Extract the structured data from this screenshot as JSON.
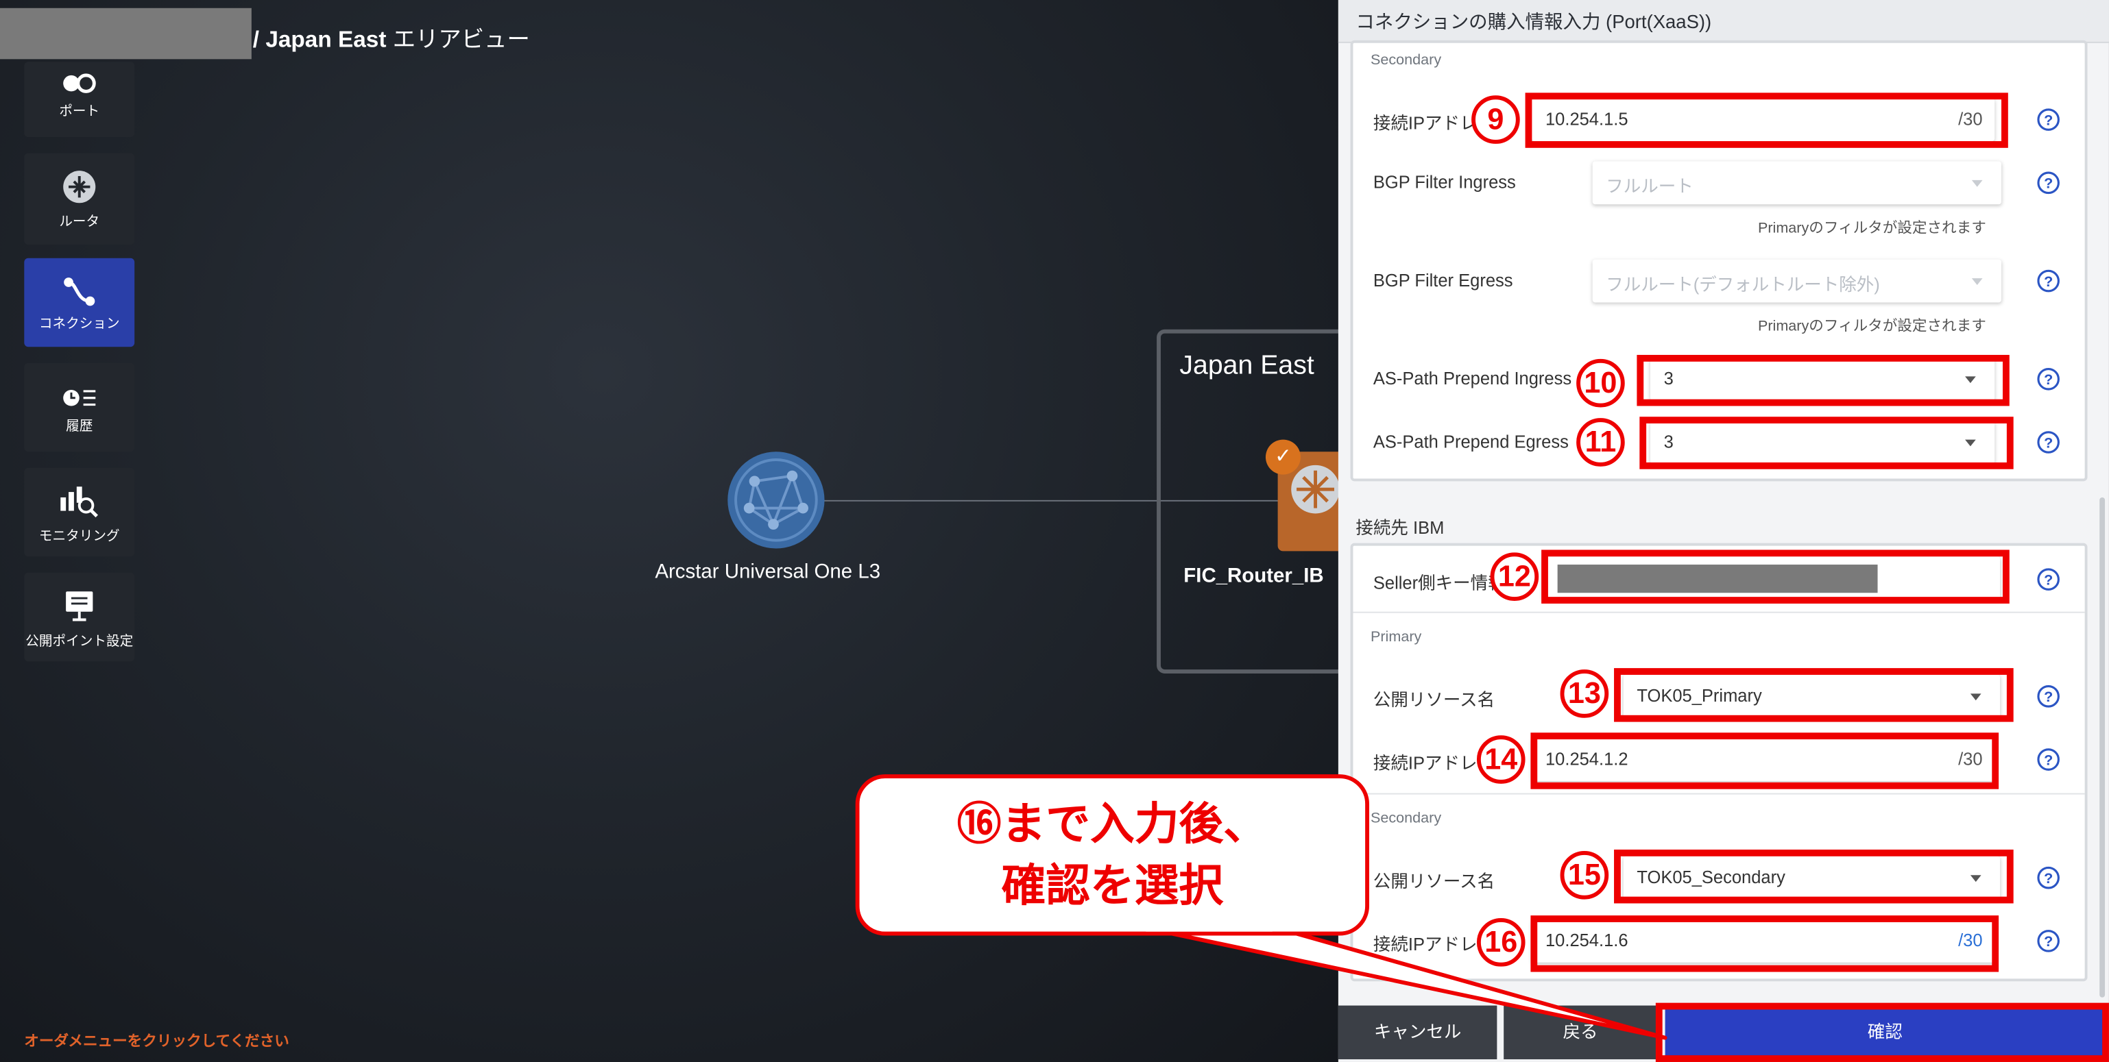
{
  "breadcrumb": {
    "area": "/ Japan East",
    "view": "エリアビュー"
  },
  "sidebar": {
    "items": [
      {
        "label": "ポート",
        "icon": "port-icon"
      },
      {
        "label": "ルータ",
        "icon": "router-icon"
      },
      {
        "label": "コネクション",
        "icon": "connection-icon",
        "active": true
      },
      {
        "label": "履歴",
        "icon": "history-icon"
      },
      {
        "label": "モニタリング",
        "icon": "monitoring-icon"
      },
      {
        "label": "公開ポイント設定",
        "icon": "public-point-icon"
      }
    ],
    "footer_message": "オーダメニューをクリックしてください"
  },
  "canvas": {
    "node_label": "Arcstar Universal One L3",
    "area_title": "Japan East",
    "router_label": "FIC_Router_IB"
  },
  "panel": {
    "title": "コネクションの購入情報入力 (Port(XaaS))",
    "secondary1": {
      "label": "Secondary",
      "ip_label": "接続IPアドレス",
      "ip_value": "10.254.1.5",
      "ip_suffix": "/30",
      "bgp_in_label": "BGP Filter Ingress",
      "bgp_in_value": "フルルート",
      "bgp_in_note": "Primaryのフィルタが設定されます",
      "bgp_eg_label": "BGP Filter Egress",
      "bgp_eg_value": "フルルート(デフォルトルート除外)",
      "bgp_eg_note": "Primaryのフィルタが設定されます",
      "asp_in_label": "AS-Path Prepend Ingress",
      "asp_in_value": "3",
      "asp_eg_label": "AS-Path Prepend Egress",
      "asp_eg_value": "3"
    },
    "destination": {
      "header": "接続先 IBM",
      "seller_key_label": "Seller側キー情報",
      "primary_label": "Primary",
      "pri_resource_label": "公開リソース名",
      "pri_resource_value": "TOK05_Primary",
      "pri_ip_label": "接続IPアドレス",
      "pri_ip_value": "10.254.1.2",
      "pri_ip_suffix": "/30",
      "secondary_label": "Secondary",
      "sec_resource_label": "公開リソース名",
      "sec_resource_value": "TOK05_Secondary",
      "sec_ip_label": "接続IPアドレス",
      "sec_ip_value": "10.254.1.6",
      "sec_ip_suffix": "/30"
    },
    "buttons": {
      "cancel": "キャンセル",
      "back": "戻る",
      "confirm": "確認"
    }
  },
  "annotations": {
    "steps": [
      "9",
      "10",
      "11",
      "12",
      "13",
      "14",
      "15",
      "16"
    ],
    "callout_line1": "⑯まで入力後、",
    "callout_line2": "確認を選択",
    "highlight_color": "#ee0000"
  }
}
